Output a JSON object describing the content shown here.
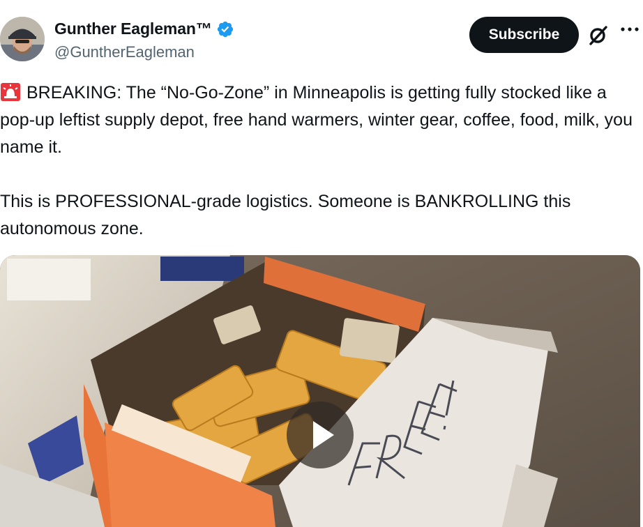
{
  "author": {
    "display_name": "Gunther Eagleman™",
    "handle": "@GuntherEagleman",
    "verified": true,
    "verified_color": "#1d9bf0"
  },
  "actions": {
    "subscribe_label": "Subscribe",
    "grok_icon": "grok-slash-icon",
    "more_icon": "more-dots-icon"
  },
  "tweet": {
    "siren_icon": "rotating-light-emoji",
    "paragraph1": "BREAKING: The “No-Go-Zone” in Minneapolis is getting fully stocked like a pop-up leftist supply depot, free hand warmers, winter gear, coffee, food, milk, you name it.",
    "paragraph2": "This is PROFESSIONAL-grade logistics. Someone is BANKROLLING this autonomous zone."
  },
  "media": {
    "type": "video",
    "play_icon": "play-icon",
    "box_handwriting": "FREE!"
  },
  "colors": {
    "text": "#0f1419",
    "secondary_text": "#536471",
    "subscribe_bg": "#0f1419"
  }
}
